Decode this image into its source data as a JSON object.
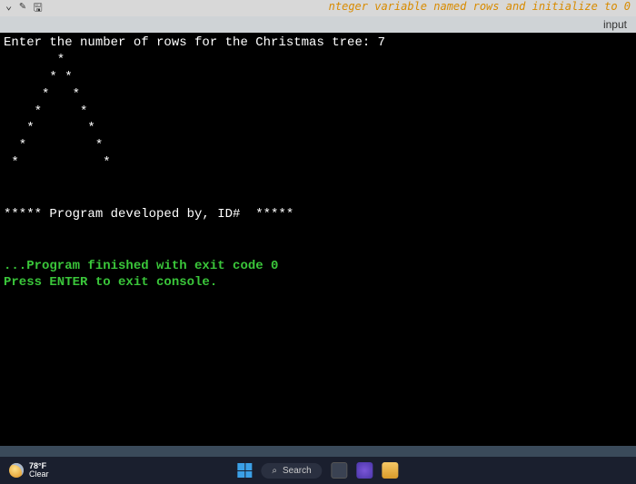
{
  "top": {
    "comment_fragment": "nteger variable named rows and initialize to 0"
  },
  "window": {
    "label": "input"
  },
  "console": {
    "prompt": "Enter the number of rows for the Christmas tree: ",
    "input_value": "7",
    "tree_lines": [
      "       *",
      "      * *",
      "     *   *",
      "    *     *",
      "   *       *",
      "  *         *",
      " *           *"
    ],
    "credit": "***** Program developed by, ID#  *****",
    "exit_msg": "...Program finished with exit code 0",
    "press_enter": "Press ENTER to exit console."
  },
  "taskbar": {
    "temp": "78°F",
    "condition": "Clear",
    "search_label": "Search"
  }
}
